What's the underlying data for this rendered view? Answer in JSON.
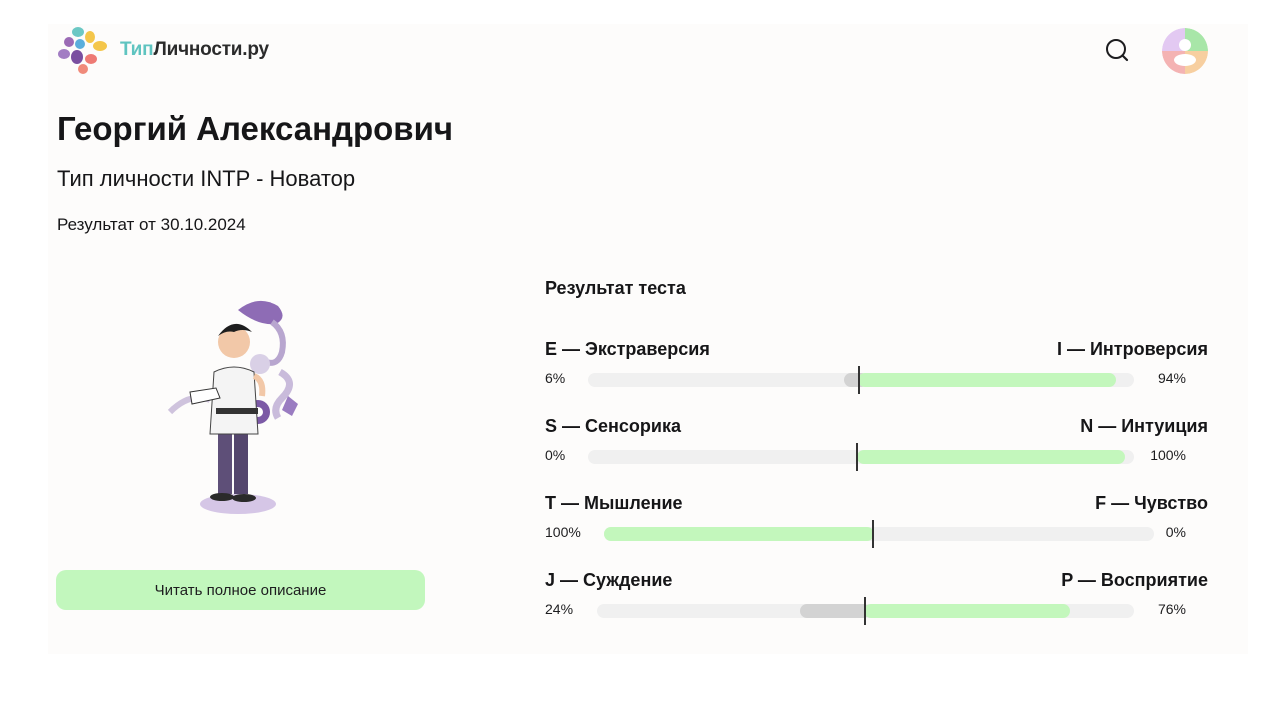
{
  "header": {
    "logo_accent": "Тип",
    "logo_rest": "Личности.ру",
    "search_icon": "search-icon",
    "avatar_icon": "avatar"
  },
  "profile": {
    "name": "Георгий Александрович",
    "type": "Тип личности INTP - Новатор",
    "date": "Результат от 30.10.2024"
  },
  "actions": {
    "read_full": "Читать полное описание"
  },
  "results": {
    "title": "Результат теста",
    "scales": [
      {
        "left_label": "E — Экстраверсия",
        "right_label": "I — Интроверсия",
        "left_pct": "6%",
        "right_pct": "94%",
        "left_value": 6,
        "right_value": 94
      },
      {
        "left_label": "S — Сенсорика",
        "right_label": "N — Интуиция",
        "left_pct": "0%",
        "right_pct": "100%",
        "left_value": 0,
        "right_value": 100
      },
      {
        "left_label": "T — Мышление",
        "right_label": "F — Чувство",
        "left_pct": "100%",
        "right_pct": "0%",
        "left_value": 100,
        "right_value": 0
      },
      {
        "left_label": "J — Суждение",
        "right_label": "P — Восприятие",
        "left_pct": "24%",
        "right_pct": "76%",
        "left_value": 24,
        "right_value": 76
      }
    ]
  },
  "colors": {
    "accent_green": "#c3f7bc",
    "neutral_grey": "#d3d3d3",
    "track": "#f0f0f0",
    "logo_teal": "#5fc4c0"
  }
}
